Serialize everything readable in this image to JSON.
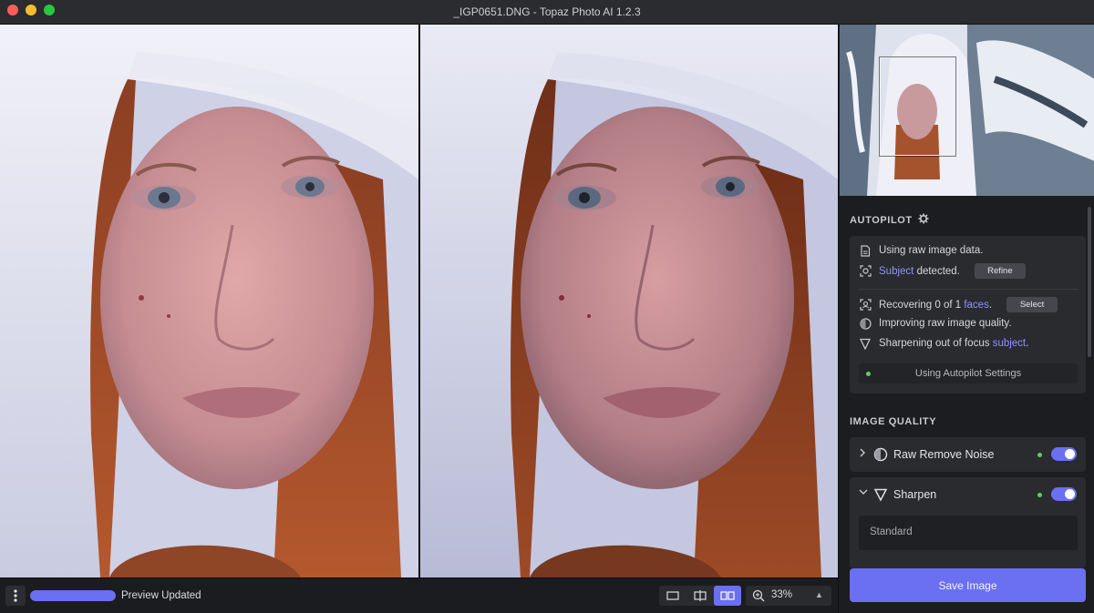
{
  "window": {
    "title": "_IGP0651.DNG - Topaz Photo AI 1.2.3"
  },
  "autopilot": {
    "title": "AUTOPILOT",
    "raw_text": "Using raw image data.",
    "subject_link": "Subject",
    "subject_text": "detected.",
    "refine_label": "Refine",
    "faces_text_1": "Recovering 0 of 1",
    "faces_link": "faces",
    "faces_text_2": ".",
    "select_label": "Select",
    "quality_text": "Improving raw image quality.",
    "sharpen_text_1": "Sharpening out of focus",
    "sharpen_link": "subject",
    "sharpen_text_2": ".",
    "status": "Using Autopilot Settings"
  },
  "image_quality": {
    "title": "IMAGE QUALITY",
    "filters": [
      {
        "label": "Raw Remove Noise",
        "expanded": false,
        "enabled": true
      },
      {
        "label": "Sharpen",
        "expanded": true,
        "enabled": true,
        "mode": "Standard"
      }
    ]
  },
  "save_label": "Save Image",
  "bottom": {
    "progress": 1.0,
    "preview_status": "Preview Updated",
    "zoom": "33%",
    "view_modes": [
      "single-view",
      "split-view",
      "side-by-side-view"
    ],
    "active_view": "side-by-side-view"
  },
  "colors": {
    "accent": "#6b6ff2",
    "status_green": "#5ad25a",
    "link": "#8d94ff"
  }
}
